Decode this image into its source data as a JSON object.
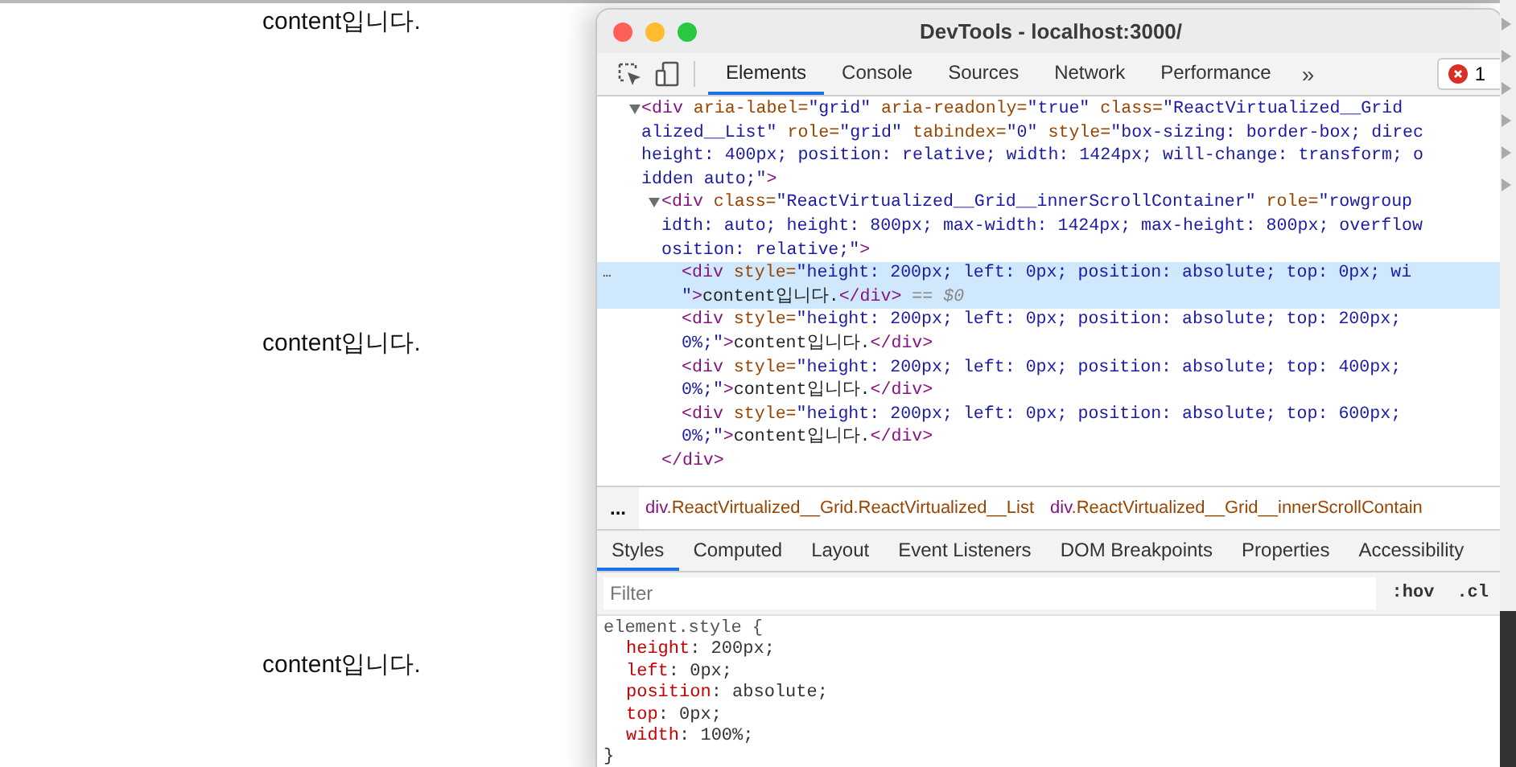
{
  "page": {
    "items": [
      "content입니다.",
      "content입니다.",
      "content입니다."
    ]
  },
  "window": {
    "title": "DevTools - localhost:3000/"
  },
  "tabs": [
    {
      "label": "Elements",
      "selected": true
    },
    {
      "label": "Console",
      "selected": false
    },
    {
      "label": "Sources",
      "selected": false
    },
    {
      "label": "Network",
      "selected": false
    },
    {
      "label": "Performance",
      "selected": false
    }
  ],
  "more_tabs": "»",
  "error_count": "1",
  "dom_tree": [
    {
      "expanded": true,
      "selected": false,
      "rows": [
        {
          "parts": [
            {
              "kind": "tag",
              "text": "<div"
            },
            {
              "kind": "attr",
              "text": " aria-label="
            },
            {
              "kind": "value",
              "text": "\"grid\""
            },
            {
              "kind": "attr",
              "text": " aria-readonly="
            },
            {
              "kind": "value",
              "text": "\"true\""
            },
            {
              "kind": "attr",
              "text": " class="
            },
            {
              "kind": "value",
              "text": "\"ReactVirtualized__Grid"
            }
          ]
        },
        {
          "parts": [
            {
              "kind": "value",
              "text": "alized__List\""
            },
            {
              "kind": "attr",
              "text": " role="
            },
            {
              "kind": "value",
              "text": "\"grid\""
            },
            {
              "kind": "attr",
              "text": " tabindex="
            },
            {
              "kind": "value",
              "text": "\"0\""
            },
            {
              "kind": "attr",
              "text": " style="
            },
            {
              "kind": "value",
              "text": "\"box-sizing: border-box; direc"
            }
          ]
        },
        {
          "parts": [
            {
              "kind": "value",
              "text": "height: 400px; position: relative; width: 1424px; will-change: transform; o"
            }
          ]
        },
        {
          "parts": [
            {
              "kind": "value",
              "text": "idden auto;\""
            },
            {
              "kind": "tag",
              "text": ">"
            }
          ]
        }
      ],
      "children": [
        {
          "expanded": true,
          "selected": false,
          "rows": [
            {
              "parts": [
                {
                  "kind": "tag",
                  "text": "<div"
                },
                {
                  "kind": "attr",
                  "text": " class="
                },
                {
                  "kind": "value",
                  "text": "\"ReactVirtualized__Grid__innerScrollContainer\""
                },
                {
                  "kind": "attr",
                  "text": " role="
                },
                {
                  "kind": "value",
                  "text": "\"rowgroup"
                }
              ]
            },
            {
              "parts": [
                {
                  "kind": "value",
                  "text": "idth: auto; height: 800px; max-width: 1424px; max-height: 800px; overflow"
                }
              ]
            },
            {
              "parts": [
                {
                  "kind": "value",
                  "text": "osition: relative;\""
                },
                {
                  "kind": "tag",
                  "text": ">"
                }
              ]
            }
          ],
          "children": [
            {
              "expanded": false,
              "selected": true,
              "gutter": "...",
              "rows": [
                {
                  "parts": [
                    {
                      "kind": "tag",
                      "text": "<div"
                    },
                    {
                      "kind": "attr",
                      "text": " style="
                    },
                    {
                      "kind": "value",
                      "text": "\"height: 200px; left: 0px; position: absolute; top: 0px; wi"
                    }
                  ]
                },
                {
                  "parts": [
                    {
                      "kind": "value",
                      "text": "\""
                    },
                    {
                      "kind": "tag",
                      "text": ">"
                    },
                    {
                      "kind": "text",
                      "text": "content입니다."
                    },
                    {
                      "kind": "tag",
                      "text": "</div>"
                    },
                    {
                      "kind": "note",
                      "text": " == $0"
                    }
                  ]
                }
              ]
            },
            {
              "expanded": false,
              "selected": false,
              "rows": [
                {
                  "parts": [
                    {
                      "kind": "tag",
                      "text": "<div"
                    },
                    {
                      "kind": "attr",
                      "text": " style="
                    },
                    {
                      "kind": "value",
                      "text": "\"height: 200px; left: 0px; position: absolute; top: 200px;"
                    }
                  ]
                },
                {
                  "parts": [
                    {
                      "kind": "value",
                      "text": "0%;\""
                    },
                    {
                      "kind": "tag",
                      "text": ">"
                    },
                    {
                      "kind": "text",
                      "text": "content입니다."
                    },
                    {
                      "kind": "tag",
                      "text": "</div>"
                    }
                  ]
                }
              ]
            },
            {
              "expanded": false,
              "selected": false,
              "rows": [
                {
                  "parts": [
                    {
                      "kind": "tag",
                      "text": "<div"
                    },
                    {
                      "kind": "attr",
                      "text": " style="
                    },
                    {
                      "kind": "value",
                      "text": "\"height: 200px; left: 0px; position: absolute; top: 400px;"
                    }
                  ]
                },
                {
                  "parts": [
                    {
                      "kind": "value",
                      "text": "0%;\""
                    },
                    {
                      "kind": "tag",
                      "text": ">"
                    },
                    {
                      "kind": "text",
                      "text": "content입니다."
                    },
                    {
                      "kind": "tag",
                      "text": "</div>"
                    }
                  ]
                }
              ]
            },
            {
              "expanded": false,
              "selected": false,
              "rows": [
                {
                  "parts": [
                    {
                      "kind": "tag",
                      "text": "<div"
                    },
                    {
                      "kind": "attr",
                      "text": " style="
                    },
                    {
                      "kind": "value",
                      "text": "\"height: 200px; left: 0px; position: absolute; top: 600px;"
                    }
                  ]
                },
                {
                  "parts": [
                    {
                      "kind": "value",
                      "text": "0%;\""
                    },
                    {
                      "kind": "tag",
                      "text": ">"
                    },
                    {
                      "kind": "text",
                      "text": "content입니다."
                    },
                    {
                      "kind": "tag",
                      "text": "</div>"
                    }
                  ]
                }
              ]
            }
          ],
          "closing": "</div>"
        }
      ]
    }
  ],
  "breadcrumbs": {
    "more": "...",
    "items": [
      {
        "tag": "div",
        "classes": ".ReactVirtualized__Grid.ReactVirtualized__List"
      },
      {
        "tag": "div",
        "classes": ".ReactVirtualized__Grid__innerScrollContain"
      }
    ]
  },
  "sub_tabs": [
    {
      "label": "Styles",
      "selected": true
    },
    {
      "label": "Computed",
      "selected": false
    },
    {
      "label": "Layout",
      "selected": false
    },
    {
      "label": "Event Listeners",
      "selected": false
    },
    {
      "label": "DOM Breakpoints",
      "selected": false
    },
    {
      "label": "Properties",
      "selected": false
    },
    {
      "label": "Accessibility",
      "selected": false
    }
  ],
  "filter": {
    "placeholder": "Filter",
    "buttons": [
      ":hov",
      ".cl"
    ]
  },
  "styles": {
    "selector": "element.style {",
    "properties": [
      {
        "name": "height",
        "value": ": 200px;"
      },
      {
        "name": "left",
        "value": ": 0px;"
      },
      {
        "name": "position",
        "value": ": absolute;"
      },
      {
        "name": "top",
        "value": ": 0px;"
      },
      {
        "name": "width",
        "value": ": 100%;"
      }
    ],
    "close": "}"
  }
}
